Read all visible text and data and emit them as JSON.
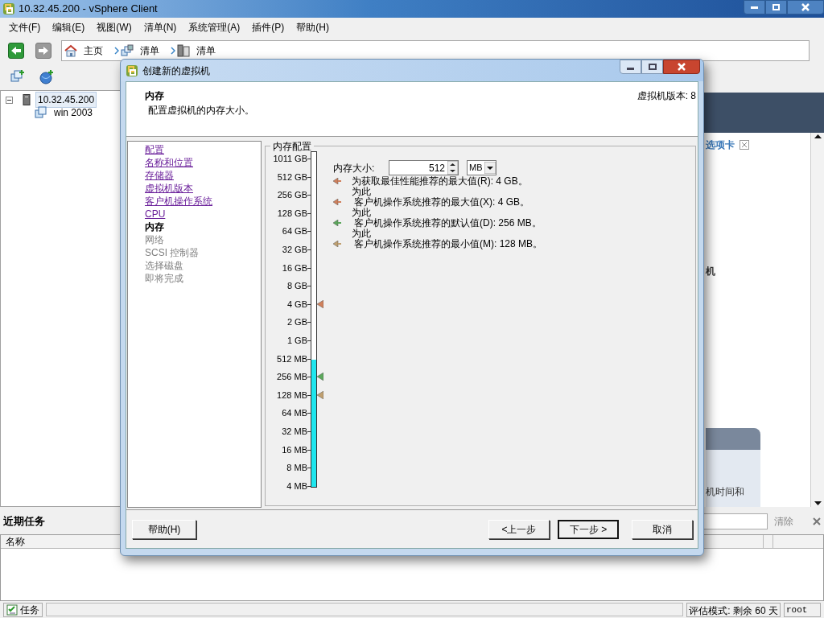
{
  "window": {
    "title": "10.32.45.200 - vSphere Client"
  },
  "menu": [
    "文件(F)",
    "编辑(E)",
    "视图(W)",
    "清单(N)",
    "系统管理(A)",
    "插件(P)",
    "帮助(H)"
  ],
  "breadcrumb": [
    {
      "label": "主页",
      "kind": "home"
    },
    {
      "label": "清单",
      "kind": "inventory"
    },
    {
      "label": "清单",
      "kind": "host"
    }
  ],
  "tree": [
    {
      "label": "10.32.45.200",
      "selected": true,
      "expanded": true,
      "children": [
        {
          "label": "win 2003",
          "selected": false
        }
      ]
    }
  ],
  "right_panel": {
    "tab_label": "选项卡",
    "heading_fragment": "机",
    "card_text": "机时间和"
  },
  "recent_tasks": {
    "title": "近期任务",
    "clear": "清除",
    "columns": [
      "名称"
    ]
  },
  "status_bar": {
    "tasks": "任务",
    "evaluation": "评估模式: 剩余 60 天",
    "user": "root"
  },
  "dialog": {
    "title": "创建新的虚拟机",
    "heading": "内存",
    "subheading": "配置虚拟机的内存大小。",
    "version": "虚拟机版本: 8",
    "steps": [
      {
        "label": "配置",
        "kind": "done"
      },
      {
        "label": "名称和位置",
        "kind": "done"
      },
      {
        "label": "存储器",
        "kind": "done"
      },
      {
        "label": "虚拟机版本",
        "kind": "done"
      },
      {
        "label": "客户机操作系统",
        "kind": "done"
      },
      {
        "label": "CPU",
        "kind": "done"
      },
      {
        "label": "内存",
        "kind": "current"
      },
      {
        "label": "网络",
        "kind": "pending"
      },
      {
        "label": "SCSI 控制器",
        "kind": "pending"
      },
      {
        "label": "选择磁盘",
        "kind": "pending"
      },
      {
        "label": "即将完成",
        "kind": "pending"
      }
    ],
    "group_title": "内存配置",
    "size_label": "内存大小:",
    "size_value": "512",
    "unit": "MB",
    "scale": {
      "level": 0.38,
      "ticks": [
        {
          "label": "1011 GB"
        },
        {
          "label": "512 GB"
        },
        {
          "label": "256 GB"
        },
        {
          "label": "128 GB"
        },
        {
          "label": "64 GB"
        },
        {
          "label": "32 GB"
        },
        {
          "label": "16 GB"
        },
        {
          "label": "8 GB"
        },
        {
          "label": "4 GB",
          "color": "#d0805c"
        },
        {
          "label": "2 GB"
        },
        {
          "label": "1 GB"
        },
        {
          "label": "512 MB"
        },
        {
          "label": "256 MB",
          "color": "#5ca85c"
        },
        {
          "label": "128 MB",
          "color": "#c0a070"
        },
        {
          "label": "64 MB"
        },
        {
          "label": "32 MB"
        },
        {
          "label": "16 MB"
        },
        {
          "label": "8 MB"
        },
        {
          "label": "4 MB"
        }
      ]
    },
    "recommendations": [
      {
        "text": "为获取最佳性能推荐的最大值(R): 4 GB。",
        "color": "#d0805c"
      },
      {
        "lead": "为此",
        "text": "客户机操作系统推荐的最大值(X): 4 GB。",
        "color": "#d0805c"
      },
      {
        "lead": "为此",
        "text": "客户机操作系统推荐的默认值(D): 256 MB。",
        "color": "#5ca85c"
      },
      {
        "lead": "为此",
        "text": "客户机操作系统推荐的最小值(M): 128 MB。",
        "color": "#c0a070"
      }
    ],
    "help_button": "帮助(H)",
    "buttons": [
      {
        "label": "<上一步",
        "default": false
      },
      {
        "label": "下一步 >",
        "default": true
      },
      {
        "label": "取消",
        "default": false
      }
    ]
  }
}
